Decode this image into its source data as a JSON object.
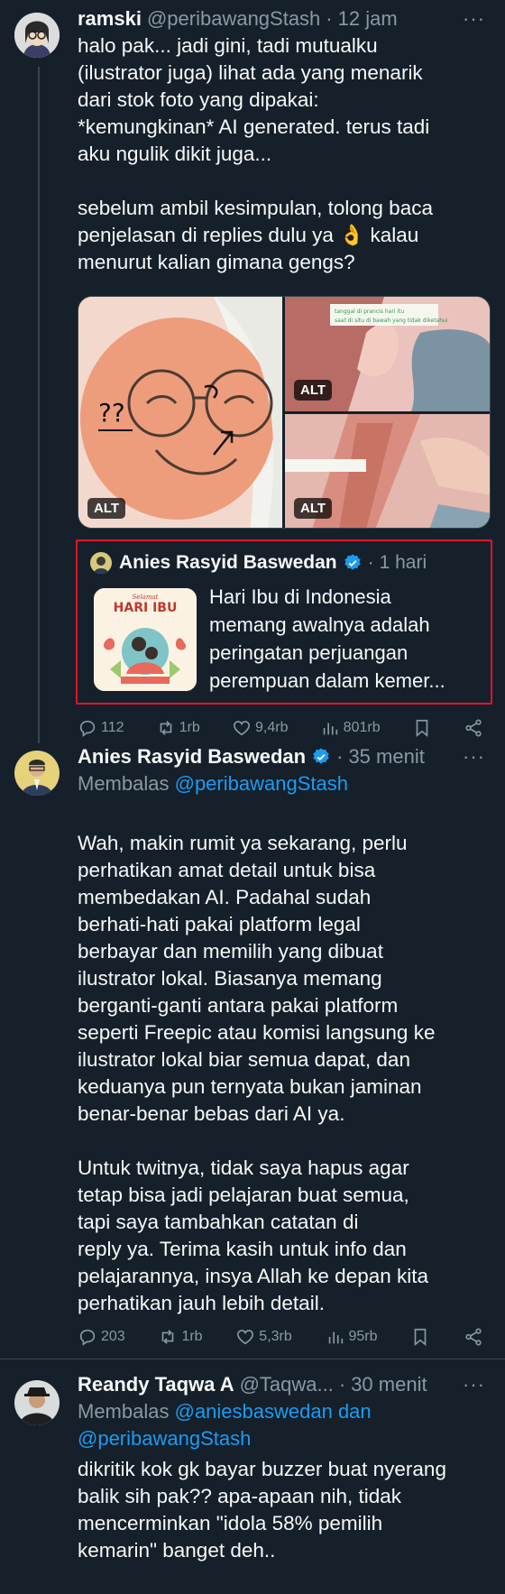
{
  "tweets": [
    {
      "name": "ramski",
      "handle": "@peribawangStash",
      "time": "12 jam",
      "more": "···",
      "lines": [
        "halo pak... jadi gini, tadi mutualku",
        "(ilustrator juga) lihat ada yang menarik",
        "dari stok foto yang dipakai:",
        "*kemungkinan* AI generated. terus tadi",
        "aku ngulik dikit juga...",
        "sebelum ambil kesimpulan, tolong baca",
        "penjelasan di replies dulu ya 👌 kalau",
        "menurut kalian gimana gengs?"
      ],
      "media_alt_label": "ALT",
      "media_texts": [
        "tanggal di prancis hari itu",
        "saat di situ di bawah yang tidak diketahui"
      ],
      "quote": {
        "name": "Anies Rasyid Baswedan",
        "time": "1 hari",
        "thumb_title_small": "Selamat",
        "thumb_title": "HARI IBU",
        "lines": [
          "Hari Ibu di Indonesia",
          "memang awalnya adalah",
          "peringatan perjuangan",
          "perempuan dalam kemer..."
        ]
      },
      "stats": {
        "replies": "112",
        "retweets": "1rb",
        "likes": "9,4rb",
        "views": "801rb"
      }
    },
    {
      "name": "Anies Rasyid Baswedan",
      "time": "35 menit",
      "more": "···",
      "reply_prefix": "Membalas",
      "reply_to": "@peribawangStash",
      "lines": [
        "Wah, makin rumit ya sekarang, perlu",
        "perhatikan amat detail untuk bisa",
        "membedakan AI. Padahal sudah",
        "berhati-hati pakai platform legal",
        "berbayar dan memilih yang dibuat",
        "ilustrator lokal. Biasanya memang",
        "berganti-ganti antara pakai platform",
        "seperti Freepic atau komisi langsung ke",
        "ilustrator lokal biar semua dapat, dan",
        "keduanya pun ternyata bukan jaminan",
        "benar-benar bebas dari AI ya.",
        "Untuk twitnya, tidak saya hapus agar",
        "tetap bisa jadi pelajaran buat semua,",
        "tapi saya tambahkan catatan di",
        "reply ya. Terima kasih untuk info dan",
        "pelajarannya, insya Allah ke depan kita",
        "perhatikan jauh lebih detail."
      ],
      "stats": {
        "replies": "203",
        "retweets": "1rb",
        "likes": "5,3rb",
        "views": "95rb"
      }
    },
    {
      "name": "Reandy Taqwa A",
      "handle": "@Taqwa...",
      "time": "30 menit",
      "more": "···",
      "reply_prefix": "Membalas",
      "reply_to_1": "@aniesbaswedan dan",
      "reply_to_2": "@peribawangStash",
      "lines": [
        "dikritik kok gk bayar buzzer buat nyerang",
        "balik sih pak?? apa-apaan nih, tidak",
        "mencerminkan \"idola 58% pemilih",
        "kemarin\" banget deh.."
      ]
    }
  ],
  "colors": {
    "bg": "#15202b",
    "text": "#f7f9f9",
    "muted": "#8b98a5",
    "link": "#1d9bf0",
    "verified": "#1d9bf0",
    "highlight": "#e0142a"
  }
}
